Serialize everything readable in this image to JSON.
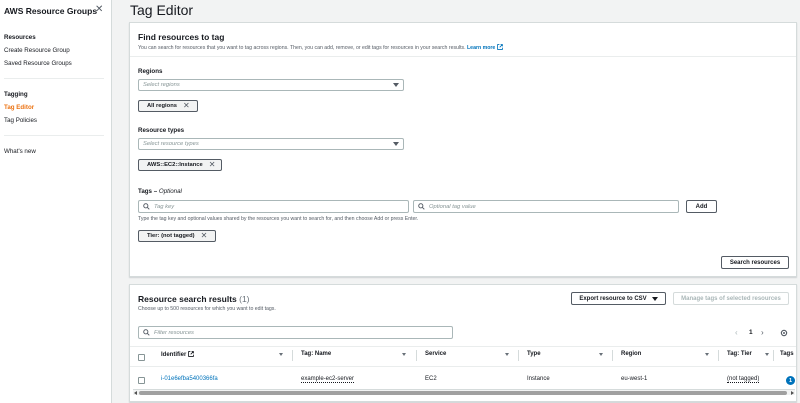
{
  "sidebar": {
    "title": "AWS Resource Groups",
    "sections": [
      {
        "heading": "Resources",
        "items": [
          "Create Resource Group",
          "Saved Resource Groups"
        ]
      },
      {
        "heading": "Tagging",
        "items": [
          "Tag Editor",
          "Tag Policies"
        ]
      }
    ],
    "whats_new": "What's new"
  },
  "page": {
    "title": "Tag Editor"
  },
  "find": {
    "title": "Find resources to tag",
    "description": "You can search for resources that you want to tag across regions. Then, you can add, remove, or edit tags for resources in your search results.",
    "learn_more": "Learn more",
    "regions": {
      "label": "Regions",
      "placeholder": "Select regions",
      "token": "All regions"
    },
    "resource_types": {
      "label": "Resource types",
      "placeholder": "Select resource types",
      "token": "AWS::EC2::Instance"
    },
    "tags": {
      "label": "Tags",
      "optional": "Optional",
      "key_placeholder": "Tag key",
      "value_placeholder": "Optional tag value",
      "add_label": "Add",
      "hint": "Type the tag key and optional values shared by the resources you want to search for, and then choose Add or press Enter.",
      "token": "Tier: (not tagged)"
    },
    "search_label": "Search resources"
  },
  "results": {
    "title": "Resource search results",
    "count": "(1)",
    "description": "Choose up to 500 resources for which you want to edit tags.",
    "export_label": "Export resource to CSV",
    "manage_label": "Manage tags of selected resources",
    "filter_placeholder": "Filter resources",
    "page_number": "1",
    "columns": [
      "Identifier",
      "Tag: Name",
      "Service",
      "Type",
      "Region",
      "Tag: Tier",
      "Tags"
    ],
    "rows": [
      {
        "identifier": "i-01e6efba5400366fa",
        "tag_name": "example-ec2-server",
        "service": "EC2",
        "type": "Instance",
        "region": "eu-west-1",
        "tag_tier": "(not tagged)",
        "tags": "1"
      }
    ]
  },
  "colors": {
    "accent": "#ec7211",
    "link": "#0073bb"
  }
}
